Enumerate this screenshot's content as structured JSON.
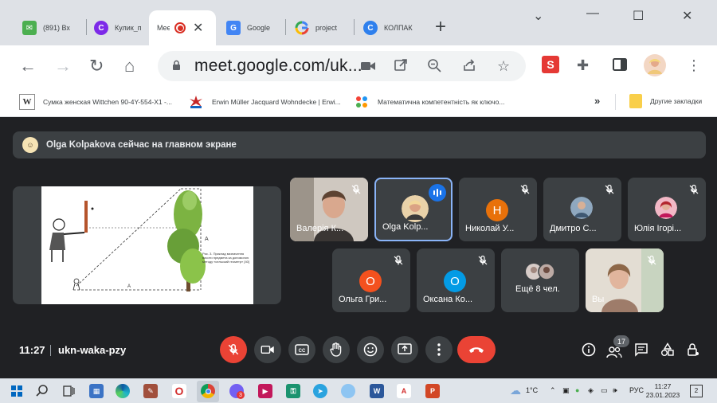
{
  "browser": {
    "tabs": [
      {
        "title": "(891) Вх",
        "favicon": "mail-icon",
        "active": false
      },
      {
        "title": "Кулик_п",
        "favicon": "canva-icon",
        "active": false
      },
      {
        "title": "Meet",
        "favicon": "meet-icon",
        "active": true,
        "recording": true
      },
      {
        "title": "Google",
        "favicon": "google-translate-icon",
        "active": false
      },
      {
        "title": "project",
        "favicon": "google-icon",
        "active": false
      },
      {
        "title": "КОЛПАК",
        "favicon": "canva-icon",
        "active": false
      }
    ],
    "url": "meet.google.com/uk...",
    "bookmarks": [
      {
        "label": "Сумка женская Wittchen 90-4Y-554-X1 -..."
      },
      {
        "label": "Erwin Müller Jacquard Wohndecke | Erwi..."
      },
      {
        "label": "Математична компетентність як ключо..."
      }
    ],
    "other_bookmarks": "Другие закладки",
    "extension_label": "S"
  },
  "meet": {
    "banner_text": "Olga Kolpakova сейчас на главном экране",
    "participants_row1": [
      {
        "name": "Валерія К...",
        "type": "video"
      },
      {
        "name": "Olga Kolp...",
        "type": "photo",
        "speaking": true
      },
      {
        "name": "Николай У...",
        "type": "letter",
        "letter": "Н",
        "color": "#e8710a"
      },
      {
        "name": "Дмитро С...",
        "type": "photo"
      },
      {
        "name": "Юлія Ігорі...",
        "type": "photo"
      }
    ],
    "participants_row2": [
      {
        "name": "Ольга Гри...",
        "type": "letter",
        "letter": "О",
        "color": "#f4511e"
      },
      {
        "name": "Оксана Ко...",
        "type": "letter",
        "letter": "О",
        "color": "#039be5"
      },
      {
        "name": "Ещё 8 чел.",
        "type": "more"
      },
      {
        "name": "Вы",
        "type": "video"
      }
    ],
    "time": "11:27",
    "meeting_code": "ukn-waka-pzy",
    "participants_count": "17",
    "slide_caption": "Рис. 3. Приклад визначення висоти предмета за допомогою методу «сельский геометр» [40]"
  },
  "taskbar": {
    "weather": "1°C",
    "language": "РУС",
    "time": "11:27",
    "date": "23.01.2023",
    "notifications": "2",
    "viber_badge": "3"
  }
}
